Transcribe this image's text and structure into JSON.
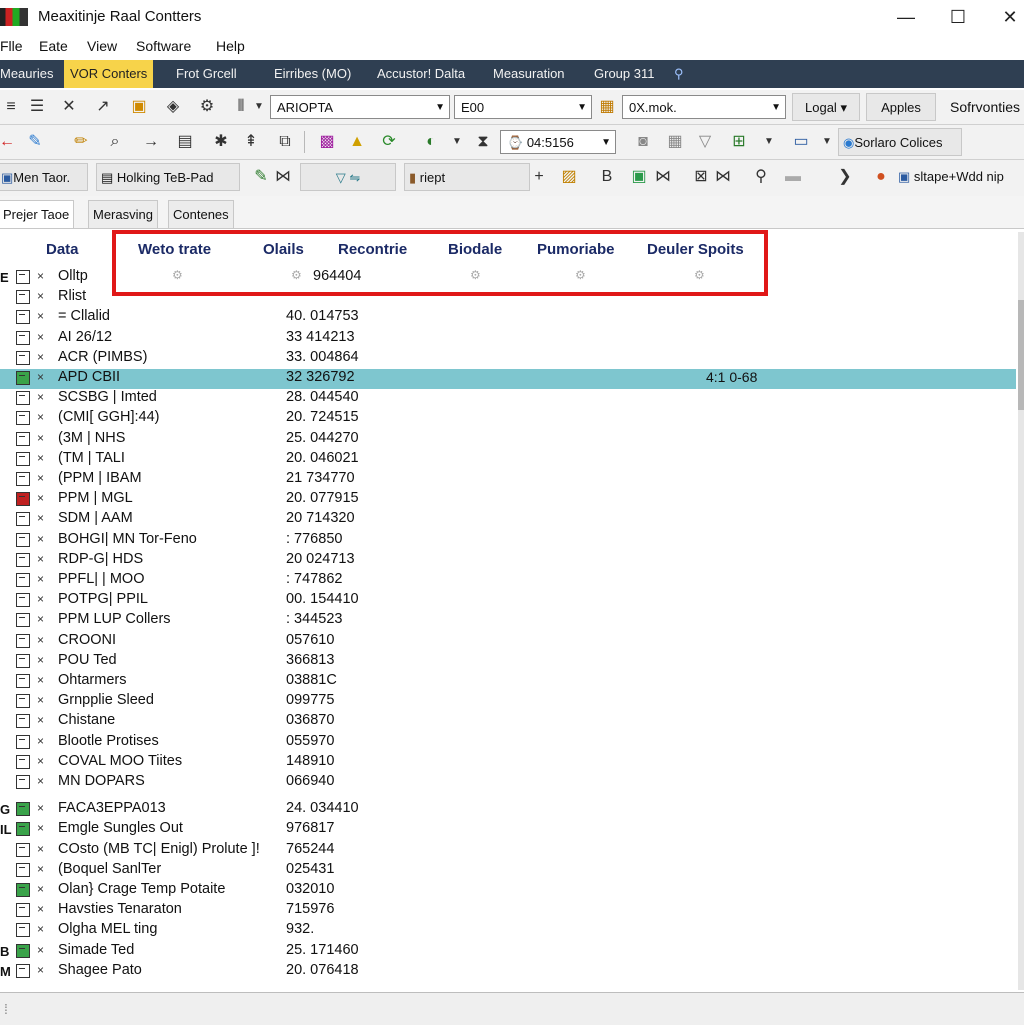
{
  "window": {
    "title": "Meaxitinje Raal Contters",
    "minimize": "—",
    "maximize": "☐",
    "close": "✕"
  },
  "menu": [
    "Flle",
    "Eate",
    "View",
    "Software",
    "Help"
  ],
  "tabs": [
    {
      "label": "Meauries",
      "active": false
    },
    {
      "label": "VOR Conters",
      "active": true
    },
    {
      "label": "Frot Grcell",
      "active": false
    },
    {
      "label": "Eirribes (MO)",
      "active": false
    },
    {
      "label": "Accustor! Dalta",
      "active": false
    },
    {
      "label": "Measuration",
      "active": false
    },
    {
      "label": "Group 311",
      "active": false
    }
  ],
  "toolbar1": {
    "combo1": "ARIOPTA",
    "combo2": "E00",
    "combo3": "0X.mok.",
    "button_logal": "Logal",
    "button_apples": "Apples",
    "text_softvonties": "Sofrvonties"
  },
  "toolbar2": {
    "time_combo": "04:5156",
    "button_collices": "Sorlaro Colices"
  },
  "toolbar3": {
    "item1": "Men Taor.",
    "item2": "Holking TeB-Pad",
    "item3": "riept",
    "item4": "sltape+Wdd nip"
  },
  "subtabs": [
    {
      "label": "Prejer Taoe",
      "active": true
    },
    {
      "label": "Merasving",
      "active": false
    },
    {
      "label": "Contenes",
      "active": false
    }
  ],
  "grid": {
    "columns": [
      "Data",
      "Weto trate",
      "Olails",
      "Recontrie",
      "Biodale",
      "Pumoriabe",
      "Deuler Spoits"
    ],
    "rows": [
      {
        "group": "E",
        "name": "Olltp",
        "value": "",
        "valtail": "964404",
        "cb": "plain"
      },
      {
        "group": "",
        "name": "Rlist",
        "value": "",
        "valtail": "",
        "cb": "plain"
      },
      {
        "group": "",
        "name": "= Cllalid",
        "value": "40. 014753",
        "cb": "plain"
      },
      {
        "group": "",
        "name": "AI 26/12",
        "value": "33 414213",
        "cb": "plain"
      },
      {
        "group": "",
        "name": "ACR (PIMBS)",
        "value": "33. 004864",
        "cb": "plain"
      },
      {
        "group": "",
        "name": "APD CBII",
        "value": "32 326792",
        "cb": "green",
        "selected": true,
        "extra": "4:1 0-68"
      },
      {
        "group": "",
        "name": "SCSBG | Imted",
        "value": "28. 044540",
        "cb": "plain"
      },
      {
        "group": "",
        "name": "(CMI[ GGH]:44)",
        "value": "20. 724515",
        "cb": "plain"
      },
      {
        "group": "",
        "name": "(3M | NHS",
        "value": "25. 044270",
        "cb": "plain"
      },
      {
        "group": "",
        "name": "(TM | TALI",
        "value": "20. 046021",
        "cb": "plain"
      },
      {
        "group": "",
        "name": "(PPM | IBAM",
        "value": "21 734770",
        "cb": "plain"
      },
      {
        "group": "",
        "name": "PPM | MGL",
        "value": "20. 077915",
        "cb": "red"
      },
      {
        "group": "",
        "name": "SDM | AAM",
        "value": "20 714320",
        "cb": "plain"
      },
      {
        "group": "",
        "name": "BOHGI| MN Tor-Feno",
        "value": ": 776850",
        "cb": "plain"
      },
      {
        "group": "",
        "name": "RDP-G| HDS",
        "value": "20 024713",
        "cb": "plain"
      },
      {
        "group": "",
        "name": "PPFL| | MOO",
        "value": ": 747862",
        "cb": "plain"
      },
      {
        "group": "",
        "name": "POTPG| PPIL",
        "value": "00. 154410",
        "cb": "plain"
      },
      {
        "group": "",
        "name": "PPM LUP Collers",
        "value": ": 344523",
        "cb": "plain"
      },
      {
        "group": "",
        "name": "CROONI",
        "value": "057610",
        "cb": "plain"
      },
      {
        "group": "",
        "name": "POU Ted",
        "value": "366813",
        "cb": "plain"
      },
      {
        "group": "",
        "name": "Ohtarmers",
        "value": "03881C",
        "cb": "plain"
      },
      {
        "group": "",
        "name": "Grnpplie Sleed",
        "value": "099775",
        "cb": "plain"
      },
      {
        "group": "",
        "name": "Chistane",
        "value": "036870",
        "cb": "plain"
      },
      {
        "group": "",
        "name": "Blootle Protises",
        "value": "055970",
        "cb": "plain"
      },
      {
        "group": "",
        "name": "COVAL MOO Tiites",
        "value": "148910",
        "cb": "plain"
      },
      {
        "group": "",
        "name": "MN DOPARS",
        "value": "066940",
        "cb": "plain"
      },
      {
        "group": "G",
        "name": "FACA3EPPA013",
        "value": "24. 034410",
        "cb": "green",
        "gap": true
      },
      {
        "group": "IL",
        "name": "Emgle Sungles Out",
        "value": "976817",
        "cb": "green"
      },
      {
        "group": "",
        "name": "COsto (MB TC| Enigl) Prolute ]!",
        "value": "765244",
        "cb": "plain"
      },
      {
        "group": "",
        "name": "(Boquel SanlTer",
        "value": "025431",
        "cb": "plain"
      },
      {
        "group": "",
        "name": "Olan} Crage Temp Potaite",
        "value": "032010",
        "cb": "green"
      },
      {
        "group": "",
        "name": "Havsties Tenaraton",
        "value": "715976",
        "cb": "plain"
      },
      {
        "group": "",
        "name": "Olgha MEL ting",
        "value": "932.",
        "cb": "plain"
      },
      {
        "group": "B",
        "name": "Simade Ted",
        "value": "25. 171460",
        "cb": "green"
      },
      {
        "group": "M",
        "name": "Shagee Pato",
        "value": "20. 076418",
        "cb": "plain"
      }
    ]
  },
  "colors": {
    "tabbar": "#2f3f52",
    "active_tab": "#f7d34a",
    "selected_row": "#7ec6cf",
    "highlight_box": "#e01818",
    "header_text": "#1b2a66"
  }
}
